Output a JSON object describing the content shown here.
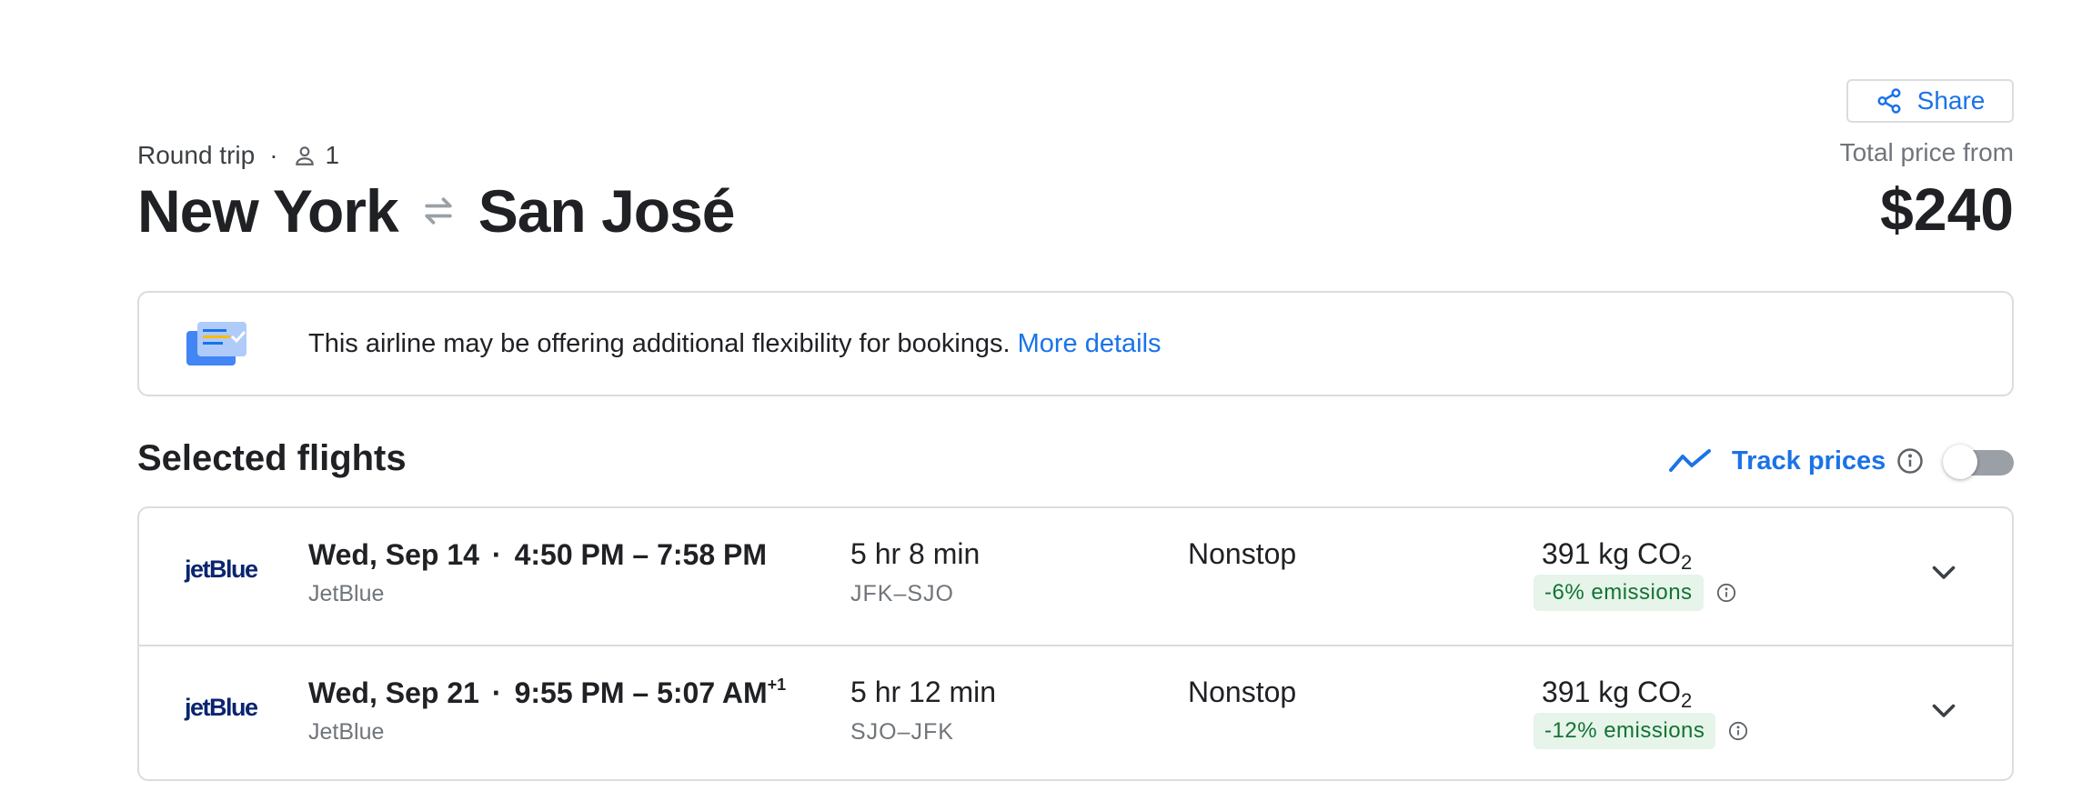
{
  "header": {
    "share_label": "Share",
    "trip_type": "Round trip",
    "passenger_count": "1",
    "origin": "New York",
    "destination": "San José",
    "total_price_label": "Total price from",
    "total_price": "$240"
  },
  "banner": {
    "text": "This airline may be offering additional flexibility for bookings.",
    "link": "More details"
  },
  "selected": {
    "title": "Selected flights",
    "track_label": "Track prices",
    "track_enabled": false
  },
  "flights": [
    {
      "airline_logo": "jetBlue",
      "date": "Wed, Sep 14",
      "times": "4:50 PM – 7:58 PM",
      "day_offset": "",
      "airline": "JetBlue",
      "duration": "5 hr 8 min",
      "airports": "JFK–SJO",
      "stops": "Nonstop",
      "co2_value": "391 kg CO",
      "co2_sub": "2",
      "emissions": "-6% emissions"
    },
    {
      "airline_logo": "jetBlue",
      "date": "Wed, Sep 21",
      "times": "9:55 PM – 5:07 AM",
      "day_offset": "+1",
      "airline": "JetBlue",
      "duration": "5 hr 12 min",
      "airports": "SJO–JFK",
      "stops": "Nonstop",
      "co2_value": "391 kg CO",
      "co2_sub": "2",
      "emissions": "-12% emissions"
    }
  ],
  "colors": {
    "accent": "#1a73e8",
    "border": "#dadce0",
    "emissions_bg": "#e6f4ea",
    "emissions_text": "#137333",
    "jetblue": "#0a2470"
  }
}
